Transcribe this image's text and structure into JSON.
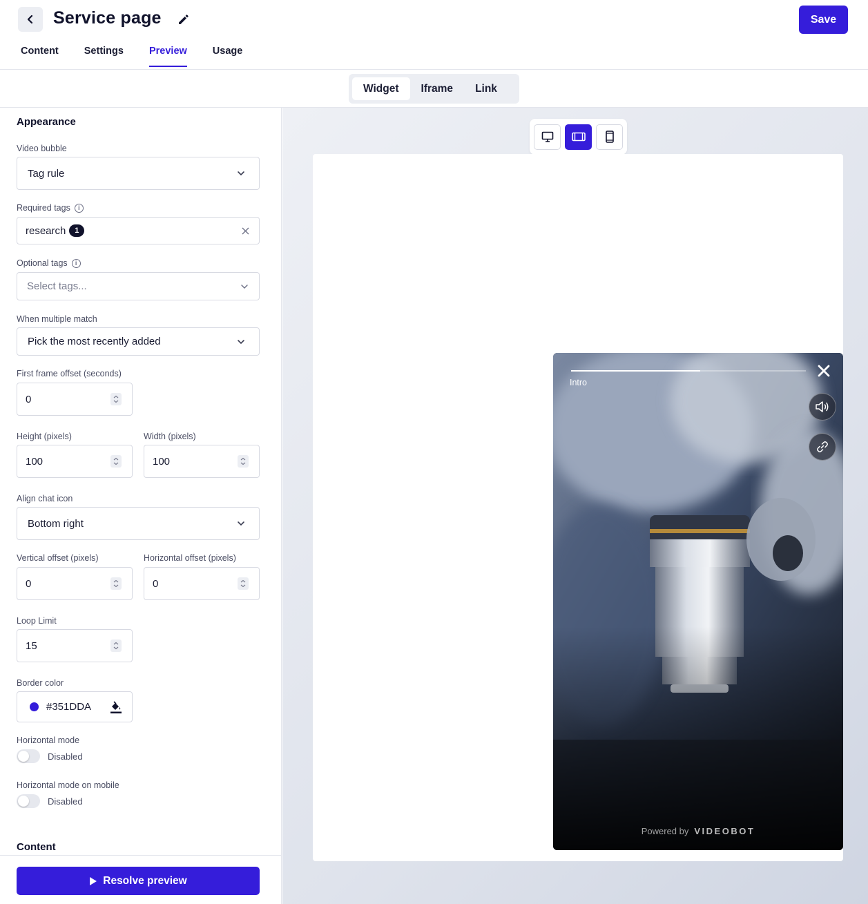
{
  "header": {
    "title": "Service page",
    "save_label": "Save",
    "tabs": [
      {
        "label": "Content",
        "active": false
      },
      {
        "label": "Settings",
        "active": false
      },
      {
        "label": "Preview",
        "active": true
      },
      {
        "label": "Usage",
        "active": false
      }
    ]
  },
  "embed_modes": [
    {
      "label": "Widget",
      "active": true
    },
    {
      "label": "Iframe",
      "active": false
    },
    {
      "label": "Link",
      "active": false
    }
  ],
  "panel": {
    "appearance_title": "Appearance",
    "video_bubble": {
      "label": "Video bubble",
      "value": "Tag rule"
    },
    "required_tags": {
      "label": "Required tags",
      "tag": "research",
      "count": "1"
    },
    "optional_tags": {
      "label": "Optional tags",
      "placeholder": "Select tags..."
    },
    "multiple_match": {
      "label": "When multiple match",
      "value": "Pick the most recently added"
    },
    "first_frame_offset": {
      "label": "First frame offset (seconds)",
      "value": "0"
    },
    "height": {
      "label": "Height (pixels)",
      "value": "100"
    },
    "width": {
      "label": "Width (pixels)",
      "value": "100"
    },
    "align_chat_icon": {
      "label": "Align chat icon",
      "value": "Bottom right"
    },
    "vertical_offset": {
      "label": "Vertical offset (pixels)",
      "value": "0"
    },
    "horizontal_offset": {
      "label": "Horizontal offset (pixels)",
      "value": "0"
    },
    "loop_limit": {
      "label": "Loop Limit",
      "value": "15"
    },
    "border_color": {
      "label": "Border color",
      "value": "#351DDA"
    },
    "horizontal_mode": {
      "label": "Horizontal mode",
      "state": "Disabled"
    },
    "horizontal_mode_mobile": {
      "label": "Horizontal mode on mobile",
      "state": "Disabled"
    },
    "content_title": "Content",
    "resolve_label": "Resolve preview"
  },
  "preview": {
    "device_options": [
      "desktop-icon",
      "tablet-landscape-icon",
      "mobile-icon"
    ],
    "active_device": "tablet-landscape-icon",
    "video": {
      "step_label": "Intro",
      "progress": 0.55,
      "powered_by": "Powered by",
      "brand": "VIDEOBOT"
    }
  },
  "colors": {
    "accent": "#351DDA",
    "text_dark": "#10122B"
  }
}
